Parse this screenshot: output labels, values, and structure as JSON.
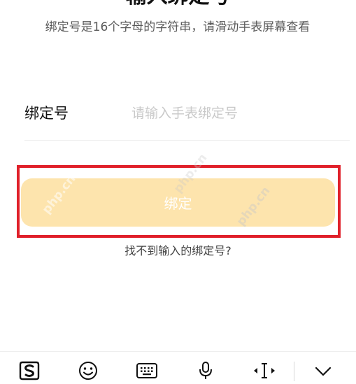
{
  "header": {
    "title": "输入绑定号"
  },
  "hint": {
    "text": "绑定号是16个字母的字符串，请滑动手表屏幕查看"
  },
  "form": {
    "label": "绑定号",
    "placeholder": "请输入手表绑定号",
    "value": ""
  },
  "bind_button": {
    "label": "绑定",
    "color": "#fde4ad"
  },
  "help_link": {
    "label": "找不到输入的绑定号?"
  },
  "watermark": {
    "text": "php.cn"
  },
  "highlight": {
    "color": "#e0202a"
  },
  "keyboard_toolbar": {
    "items": [
      {
        "icon": "sogou-logo-icon"
      },
      {
        "icon": "emoji-icon"
      },
      {
        "icon": "keyboard-icon"
      },
      {
        "icon": "microphone-icon"
      },
      {
        "icon": "text-cursor-icon"
      },
      {
        "icon": "chevron-down-icon"
      }
    ]
  }
}
